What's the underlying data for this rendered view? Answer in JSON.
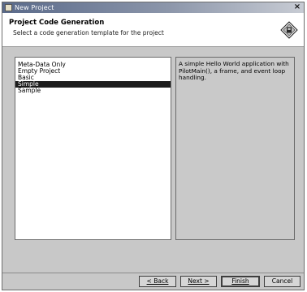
{
  "window": {
    "title": "New Project",
    "close_label": "×"
  },
  "header": {
    "title": "Project Code Generation",
    "subtitle": "Select a code generation template for the project"
  },
  "templates": {
    "items": [
      {
        "label": "Meta-Data Only",
        "selected": false
      },
      {
        "label": "Empty Project",
        "selected": false
      },
      {
        "label": "Basic",
        "selected": false
      },
      {
        "label": "Simple",
        "selected": true
      },
      {
        "label": "Sample",
        "selected": false
      }
    ]
  },
  "description": {
    "text": "A simple Hello World application with PilotMain(), a frame, and event loop handling."
  },
  "buttons": {
    "back": "< Back",
    "next": "Next >",
    "finish": "Finish",
    "cancel": "Cancel"
  },
  "colors": {
    "selection": "#1c1c1c",
    "dialog_bg": "#c8c8c8"
  }
}
